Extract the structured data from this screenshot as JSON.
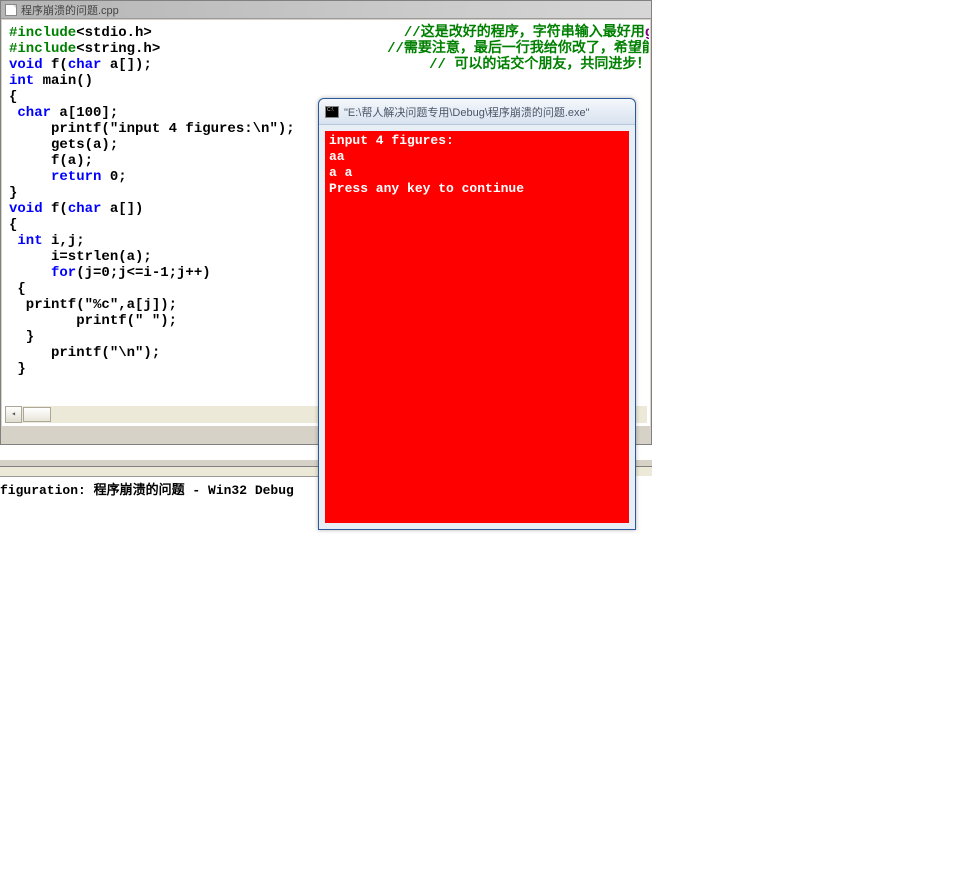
{
  "ide": {
    "filename": "程序崩溃的问题.cpp",
    "code": {
      "l1_kw": "#include",
      "l1_rest": "<stdio.h>",
      "l1_comment": "//这是改好的程序，字符串输入最好用",
      "l1_kw2": "gets",
      "l2_kw": "#include",
      "l2_rest": "<string.h>",
      "l2_comment": "//需要注意，最后一行我给你改了，希望能帮",
      "l3_void": "void",
      "l3_rest": " f(",
      "l3_char": "char",
      "l3_rest2": " a[]);",
      "l3_comment": "// 可以的话交个朋友，共同进步！",
      "l4_int": "int",
      "l4_rest": " main()",
      "l5": "{",
      "l6_char": " char",
      "l6_rest": " a[100];",
      "l7": "     printf(\"input 4 figures:\\n\");",
      "l8": "     gets(a);",
      "l9": "     f(a);",
      "l10_ret": "     return",
      "l10_rest": " 0;",
      "l11": "}",
      "l12_void": "void",
      "l12_rest": " f(",
      "l12_char": "char",
      "l12_rest2": " a[])",
      "l13": "{",
      "l14_int": " int",
      "l14_rest": " i,j;",
      "l15": "     i=strlen(a);",
      "l16_for": "     for",
      "l16_rest": "(j=0;j<=i-1;j++)",
      "l17": " {",
      "l18": "  printf(\"%c\",a[j]);",
      "l19": "        printf(\" \");",
      "l20": "  }",
      "l21": "     printf(\"\\n\");",
      "l22": " }"
    }
  },
  "output_panel": {
    "text": "figuration: 程序崩溃的问题 - Win32 Debug"
  },
  "console": {
    "title": "\"E:\\帮人解决问题专用\\Debug\\程序崩溃的问题.exe\"",
    "lines": [
      "input 4 figures:",
      "aa",
      "a a",
      "Press any key to continue"
    ]
  }
}
